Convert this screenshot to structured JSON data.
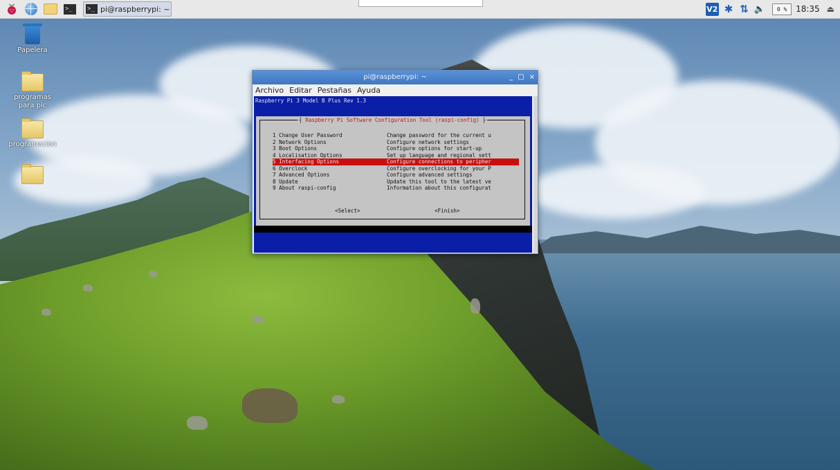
{
  "taskbar": {
    "task_label": "pi@raspberrypi: ~",
    "term_glyph": ">_",
    "tray": {
      "vnc_label": "V2",
      "bt_glyph": "✱",
      "net_glyph": "⇅",
      "vol_glyph": "🔈",
      "cpu": "0 %",
      "clock": "18:35",
      "eject_glyph": "⏏"
    }
  },
  "desktop": {
    "icons": [
      {
        "label": "Papelera"
      },
      {
        "label": "programas\npara plc"
      },
      {
        "label": "programacion"
      },
      {
        "label": ""
      }
    ]
  },
  "window": {
    "title": "pi@raspberrypi: ~",
    "controls": {
      "minimize": "_",
      "maximize": "□",
      "close": "×"
    },
    "menu": [
      "Archivo",
      "Editar",
      "Pestañas",
      "Ayuda"
    ],
    "header_line": "Raspberry Pi 3 Model B Plus Rev 1.3",
    "dialog": {
      "title": "Raspberry Pi Software Configuration Tool (raspi-config)",
      "items": [
        {
          "key": "1 Change User Password",
          "desc": "Change password for the current u",
          "selected": false
        },
        {
          "key": "2 Network Options",
          "desc": "Configure network settings",
          "selected": false
        },
        {
          "key": "3 Boot Options",
          "desc": "Configure options for start-up",
          "selected": false
        },
        {
          "key": "4 Localisation Options",
          "desc": "Set up language and regional sett",
          "selected": false
        },
        {
          "key": "5 Interfacing Options",
          "desc": "Configure connections to peripher",
          "selected": true
        },
        {
          "key": "6 Overclock",
          "desc": "Configure overclocking for your P",
          "selected": false
        },
        {
          "key": "7 Advanced Options",
          "desc": "Configure advanced settings",
          "selected": false
        },
        {
          "key": "8 Update",
          "desc": "Update this tool to the latest ve",
          "selected": false
        },
        {
          "key": "9 About raspi-config",
          "desc": "Information about this configurat",
          "selected": false
        }
      ],
      "select_button": "<Select>",
      "finish_button": "<Finish>"
    }
  }
}
